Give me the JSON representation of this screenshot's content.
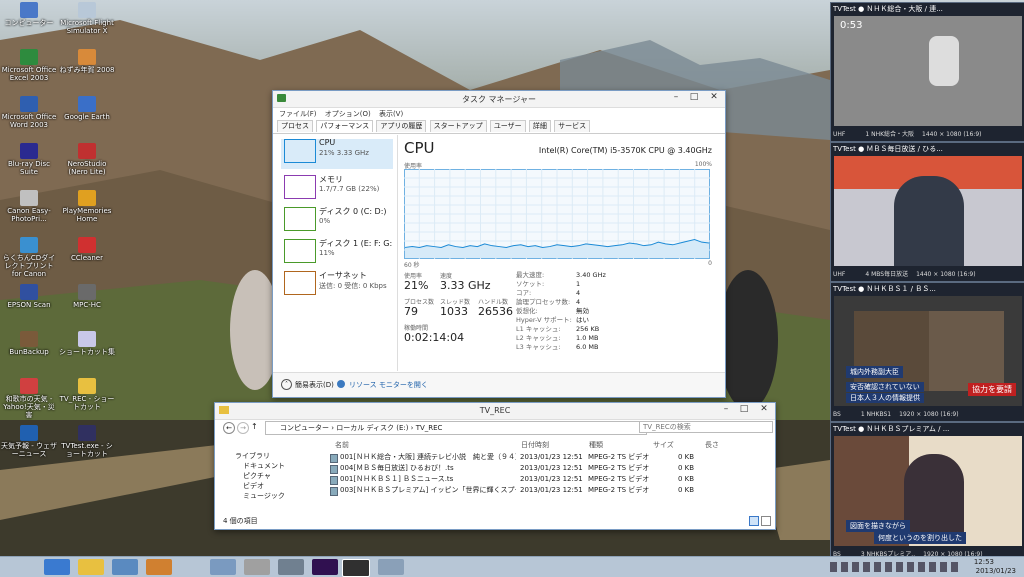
{
  "desktop_icons": [
    {
      "label": "コンピューター",
      "color": "#4a78c8"
    },
    {
      "label": "Microsoft Flight Simulator X",
      "color": "#b8c8d8"
    },
    {
      "label": "Microsoft Office Excel 2003",
      "color": "#2e8b3e"
    },
    {
      "label": "ねずみ年賀 2008",
      "color": "#d88a3a"
    },
    {
      "label": "Microsoft Office Word 2003",
      "color": "#2f5fb0"
    },
    {
      "label": "Google Earth",
      "color": "#3a6fc8"
    },
    {
      "label": "Blu-ray Disc Suite",
      "color": "#2a2a90"
    },
    {
      "label": "NeroStudio (Nero Lite)",
      "color": "#c03030"
    },
    {
      "label": "Canon Easy-PhotoPri...",
      "color": "#c0c0c0"
    },
    {
      "label": "PlayMemories Home",
      "color": "#e0a020"
    },
    {
      "label": "らくちんCDダイレクトプリント for Canon",
      "color": "#3a90d0"
    },
    {
      "label": "CCleaner",
      "color": "#d03030"
    },
    {
      "label": "EPSON Scan",
      "color": "#3050a0"
    },
    {
      "label": "MPC-HC",
      "color": "#6a6a6a"
    },
    {
      "label": "BunBackup",
      "color": "#7a5a3a"
    },
    {
      "label": "ショートカット集",
      "color": "#c8c8e8"
    },
    {
      "label": "和歌市の天気 - Yahoo!天気・災害",
      "color": "#d04040"
    },
    {
      "label": "TV_REC - ショートカット",
      "color": "#e8c040"
    },
    {
      "label": "天気予報 - ウェザーニュース",
      "color": "#2060b0"
    },
    {
      "label": "TVTest.exe - ショートカット",
      "color": "#303060"
    }
  ],
  "task_manager": {
    "title": "タスク マネージャー",
    "menu": [
      "ファイル(F)",
      "オプション(O)",
      "表示(V)"
    ],
    "tabs": [
      "プロセス",
      "パフォーマンス",
      "アプリの履歴",
      "スタートアップ",
      "ユーザー",
      "詳細",
      "サービス"
    ],
    "side": [
      {
        "name": "CPU",
        "sub": "21% 3.33 GHz",
        "color": "#1b8ad6"
      },
      {
        "name": "メモリ",
        "sub": "1.7/7.7 GB (22%)",
        "color": "#8b3bb0"
      },
      {
        "name": "ディスク 0 (C: D:)",
        "sub": "0%",
        "color": "#4a9a2a"
      },
      {
        "name": "ディスク 1 (E: F: G:",
        "sub": "11%",
        "color": "#4a9a2a"
      },
      {
        "name": "イーサネット",
        "sub": "送信: 0 受信: 0 Kbps",
        "color": "#b0661e"
      }
    ],
    "main_title": "CPU",
    "cpu_name": "Intel(R) Core(TM) i5-3570K CPU @ 3.40GHz",
    "graph_label_left": "使用率",
    "graph_label_right": "100%",
    "graph_bottom_left": "60 秒",
    "graph_bottom_right": "0",
    "graph_line": [
      0.12,
      0.13,
      0.12,
      0.14,
      0.13,
      0.12,
      0.15,
      0.13,
      0.12,
      0.14,
      0.13,
      0.16,
      0.14,
      0.13,
      0.12,
      0.14,
      0.15,
      0.13,
      0.14,
      0.12,
      0.13,
      0.15,
      0.14,
      0.13,
      0.14,
      0.16,
      0.15,
      0.14,
      0.13,
      0.14,
      0.15,
      0.17,
      0.16,
      0.14,
      0.15,
      0.18,
      0.16,
      0.15,
      0.17,
      0.19,
      0.21,
      0.18,
      0.17
    ],
    "stats": {
      "usage_label": "使用率",
      "usage": "21%",
      "speed_label": "速度",
      "speed": "3.33 GHz",
      "proc_label": "プロセス数",
      "proc": "79",
      "thread_label": "スレッド数",
      "thread": "1033",
      "handle_label": "ハンドル数",
      "handle": "26536",
      "uptime_label": "稼働時間",
      "uptime": "0:02:14:04"
    },
    "specs": [
      {
        "k": "最大速度:",
        "v": "3.40 GHz"
      },
      {
        "k": "ソケット:",
        "v": "1"
      },
      {
        "k": "コア:",
        "v": "4"
      },
      {
        "k": "論理プロセッサ数:",
        "v": "4"
      },
      {
        "k": "仮想化:",
        "v": "無効"
      },
      {
        "k": "Hyper-V サポート:",
        "v": "はい"
      },
      {
        "k": "L1 キャッシュ:",
        "v": "256 KB"
      },
      {
        "k": "L2 キャッシュ:",
        "v": "1.0 MB"
      },
      {
        "k": "L3 キャッシュ:",
        "v": "6.0 MB"
      }
    ],
    "fewer_details": "簡易表示(D)",
    "resource_monitor": "リソース モニターを開く"
  },
  "explorer": {
    "title": "TV_REC",
    "breadcrumb": [
      "コンピューター",
      "ローカル ディスク (E:)",
      "TV_REC"
    ],
    "search_placeholder": "TV_RECの検索",
    "nav": [
      "ライブラリ",
      "ドキュメント",
      "ピクチャ",
      "ビデオ",
      "ミュージック"
    ],
    "cols": [
      "名前",
      "日付時刻",
      "種類",
      "サイズ",
      "長さ"
    ],
    "files": [
      {
        "name": "001[ＮＨＫ総合・大阪] 連続テレビ小説　純と愛（９４）「えい...",
        "date": "2013/01/23 12:51",
        "type": "MPEG-2 TS ビデオ",
        "size": "0 KB"
      },
      {
        "name": "004[ＭＢＳ毎日放送] ひるおび！.ts",
        "date": "2013/01/23 12:51",
        "type": "MPEG-2 TS ビデオ",
        "size": "0 KB"
      },
      {
        "name": "001[ＮＨＫＢＳ１] ＢＳニュース.ts",
        "date": "2013/01/23 12:51",
        "type": "MPEG-2 TS ビデオ",
        "size": "0 KB"
      },
      {
        "name": "003[ＮＨＫＢＳプレミアム] イッピン「世界に輝くスプーンとフォーク...",
        "date": "2013/01/23 12:51",
        "type": "MPEG-2 TS ビデオ",
        "size": "0 KB"
      }
    ],
    "status": "4 個の項目"
  },
  "tv_windows": [
    {
      "title": "TVTest ● ＮＨＫ総合・大阪 / 連...",
      "left": "UHF",
      "mid": "1 NHK総合・大阪",
      "res": "1440 × 1080 (16:9)",
      "overlay": "0:53",
      "scene": "#8a8a8a"
    },
    {
      "title": "TVTest ● ＭＢＳ毎日放送 / ひる...",
      "left": "UHF",
      "mid": "4 MBS毎日放送",
      "res": "1440 × 1080 (16:9)",
      "overlay": "",
      "scene": "#b8b8c0"
    },
    {
      "title": "TVTest ● ＮＨＫＢＳ１ / ＢＳ...",
      "left": "BS",
      "mid": "1 NHKBS1",
      "res": "1920 × 1080 (16:9)",
      "overlay": "城内外務副大臣",
      "scene": "#3a3a3a"
    },
    {
      "title": "TVTest ● ＮＨＫＢＳプレミアム / ...",
      "left": "BS",
      "mid": "3 NHKBSプレミア..",
      "res": "1920 × 1080 (16:9)",
      "overlay": "図面を描きながら",
      "scene": "#8a6a4a"
    }
  ],
  "tv_captions": [
    "安否確認されていない",
    "日本人３人の情報提供",
    "協力を要請",
    "何度というのを割り出した"
  ],
  "taskbar": {
    "time": "12:53",
    "date": "2013/01/23"
  }
}
